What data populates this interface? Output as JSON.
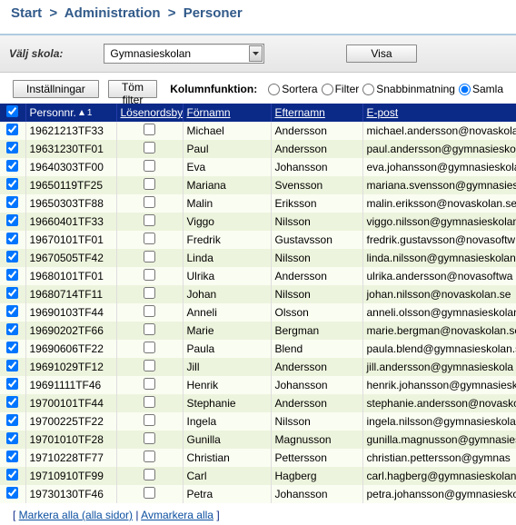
{
  "breadcrumb": {
    "start": "Start",
    "admin": "Administration",
    "personer": "Personer"
  },
  "filter": {
    "label": "Välj skola:",
    "school_selected": "Gymnasieskolan",
    "visa": "Visa"
  },
  "toolbar": {
    "settings": "Inställningar",
    "clear": "Töm filter",
    "colfunc_label": "Kolumnfunktion:",
    "opt_sort": "Sortera",
    "opt_filter": "Filter",
    "opt_quick": "Snabbinmatning",
    "opt_collect": "Samla"
  },
  "columns": {
    "personnr": "Personnr.",
    "pwchange": "Lösenordsbyte",
    "first": "Förnamn",
    "last": "Efternamn",
    "email": "E-post"
  },
  "rows": [
    {
      "sel": true,
      "pn": "19621213TF33",
      "pw": false,
      "fn": "Michael",
      "ln": "Andersson",
      "em": "michael.andersson@novaskolan"
    },
    {
      "sel": true,
      "pn": "19631230TF01",
      "pw": false,
      "fn": "Paul",
      "ln": "Andersson",
      "em": "paul.andersson@gymnasieskol"
    },
    {
      "sel": true,
      "pn": "19640303TF00",
      "pw": false,
      "fn": "Eva",
      "ln": "Johansson",
      "em": "eva.johansson@gymnasieskola"
    },
    {
      "sel": true,
      "pn": "19650119TF25",
      "pw": false,
      "fn": "Mariana",
      "ln": "Svensson",
      "em": "mariana.svensson@gymnasiesk"
    },
    {
      "sel": true,
      "pn": "19650303TF88",
      "pw": false,
      "fn": "Malin",
      "ln": "Eriksson",
      "em": "malin.eriksson@novaskolan.se"
    },
    {
      "sel": true,
      "pn": "19660401TF33",
      "pw": false,
      "fn": "Viggo",
      "ln": "Nilsson",
      "em": "viggo.nilsson@gymnasieskolan"
    },
    {
      "sel": true,
      "pn": "19670101TF01",
      "pw": false,
      "fn": "Fredrik",
      "ln": "Gustavsson",
      "em": "fredrik.gustavsson@novasoftw"
    },
    {
      "sel": true,
      "pn": "19670505TF42",
      "pw": false,
      "fn": "Linda",
      "ln": "Nilsson",
      "em": "linda.nilsson@gymnasieskolan"
    },
    {
      "sel": true,
      "pn": "19680101TF01",
      "pw": false,
      "fn": "Ulrika",
      "ln": "Andersson",
      "em": "ulrika.andersson@novasoftwa"
    },
    {
      "sel": true,
      "pn": "19680714TF11",
      "pw": false,
      "fn": "Johan",
      "ln": "Nilsson",
      "em": "johan.nilsson@novaskolan.se"
    },
    {
      "sel": true,
      "pn": "19690103TF44",
      "pw": false,
      "fn": "Anneli",
      "ln": "Olsson",
      "em": "anneli.olsson@gymnasieskolan"
    },
    {
      "sel": true,
      "pn": "19690202TF66",
      "pw": false,
      "fn": "Marie",
      "ln": "Bergman",
      "em": "marie.bergman@novaskolan.se"
    },
    {
      "sel": true,
      "pn": "19690606TF22",
      "pw": false,
      "fn": "Paula",
      "ln": "Blend",
      "em": "paula.blend@gymnasieskolan.s"
    },
    {
      "sel": true,
      "pn": "19691029TF12",
      "pw": false,
      "fn": "Jill",
      "ln": "Andersson",
      "em": "jill.andersson@gymnasieskola"
    },
    {
      "sel": true,
      "pn": "19691111TF46",
      "pw": false,
      "fn": "Henrik",
      "ln": "Johansson",
      "em": "henrik.johansson@gymnasiesk"
    },
    {
      "sel": true,
      "pn": "19700101TF44",
      "pw": false,
      "fn": "Stephanie",
      "ln": "Andersson",
      "em": "stephanie.andersson@novasko"
    },
    {
      "sel": true,
      "pn": "19700225TF22",
      "pw": false,
      "fn": "Ingela",
      "ln": "Nilsson",
      "em": "ingela.nilsson@gymnasieskola"
    },
    {
      "sel": true,
      "pn": "19701010TF28",
      "pw": false,
      "fn": "Gunilla",
      "ln": "Magnusson",
      "em": "gunilla.magnusson@gymnasies"
    },
    {
      "sel": true,
      "pn": "19710228TF77",
      "pw": false,
      "fn": "Christian",
      "ln": "Pettersson",
      "em": "christian.pettersson@gymnas"
    },
    {
      "sel": true,
      "pn": "19710910TF99",
      "pw": false,
      "fn": "Carl",
      "ln": "Hagberg",
      "em": "carl.hagberg@gymnasieskolan."
    },
    {
      "sel": true,
      "pn": "19730130TF46",
      "pw": false,
      "fn": "Petra",
      "ln": "Johansson",
      "em": "petra.johansson@gymnasiesko"
    }
  ],
  "footer": {
    "open": "[ ",
    "mark_all": "Markera alla (alla sidor)",
    "sep": " | ",
    "unmark_all": "Avmarkera alla",
    "close": " ]"
  }
}
